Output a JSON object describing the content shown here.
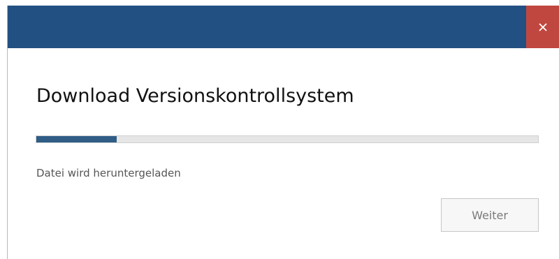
{
  "window": {
    "close_icon": "close-icon",
    "colors": {
      "titlebar": "#225082",
      "close_button": "#c0473f",
      "progress_fill": "#2f5d86"
    }
  },
  "main": {
    "title": "Download Versionskontrollsystem",
    "status_text": "Datei wird heruntergeladen",
    "progress_fraction": 0.16
  },
  "footer": {
    "next_label": "Weiter",
    "next_enabled": false
  }
}
